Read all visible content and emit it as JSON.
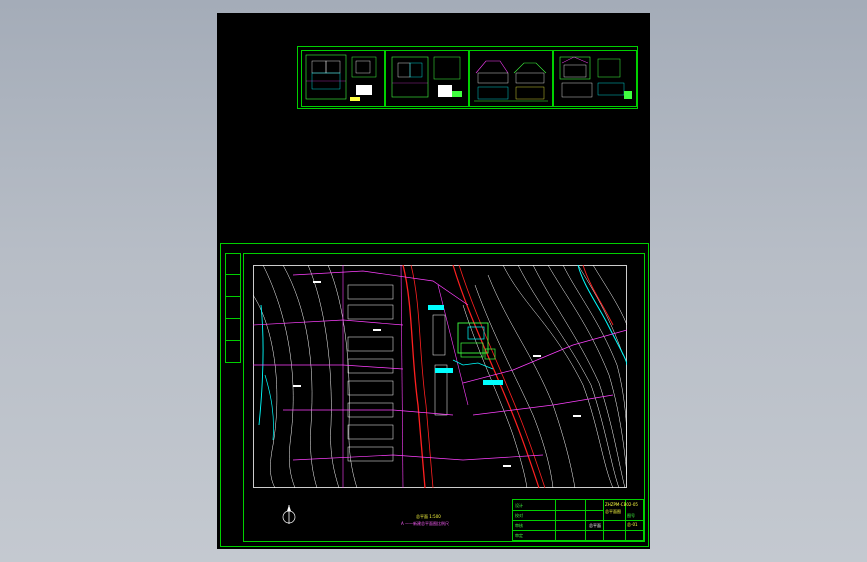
{
  "viewer": {
    "background_color": "#000000",
    "line_colors": {
      "frame": "#00d000",
      "contour": "#ffffff",
      "road": "#ff2020",
      "boundary": "#ff40ff",
      "site": "#00ffff",
      "highlight": "#40ff40"
    }
  },
  "thumbnails": [
    {
      "name": "floor-plan-1"
    },
    {
      "name": "floor-plan-2"
    },
    {
      "name": "elevation"
    },
    {
      "name": "section"
    }
  ],
  "sheet": {
    "north_symbol_icon": "north-arrow-icon",
    "caption_main": "总平面",
    "caption_scale": "1:500",
    "caption_note": "A ——新建总平面图比例尺"
  },
  "title_block": {
    "drawing_code": "ZHZPM-CB02-05",
    "drawing_name": "总平面图",
    "sheet_label": "总平面",
    "stamp_label": "图号",
    "stamp_value": "总-01",
    "row_labels": [
      "设计",
      "校对",
      "审核",
      "审定"
    ]
  }
}
